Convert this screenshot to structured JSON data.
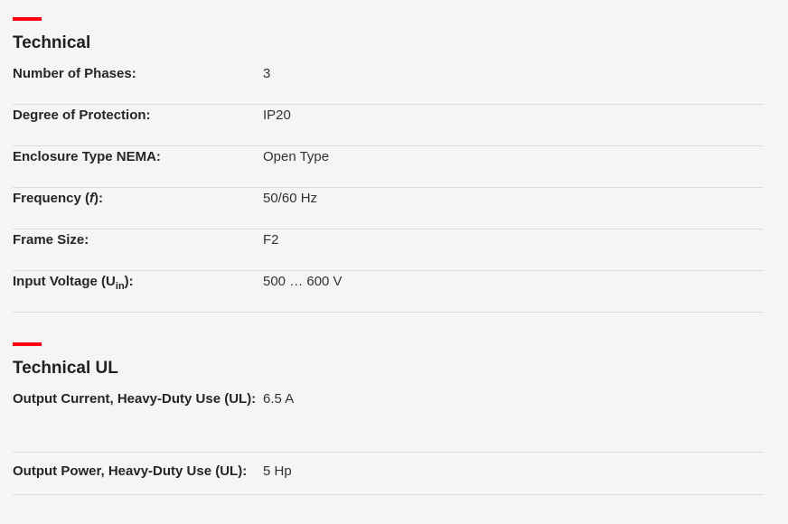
{
  "sections": [
    {
      "title": "Technical",
      "rows": [
        {
          "label": "Number of Phases:",
          "value": "3"
        },
        {
          "label": "Degree of Protection:",
          "value": "IP20"
        },
        {
          "label": "Enclosure Type NEMA:",
          "value": "Open Type"
        },
        {
          "label_prefix": "Frequency (",
          "label_italic": "f",
          "label_suffix": "):",
          "value": "50/60 Hz"
        },
        {
          "label": "Frame Size:",
          "value": "F2"
        },
        {
          "label_prefix": "Input Voltage (U",
          "label_sub": "in",
          "label_suffix": "):",
          "value": "500 … 600 V"
        }
      ]
    },
    {
      "title": "Technical UL",
      "rows": [
        {
          "label": "Output Current, Heavy-Duty Use (UL):",
          "value": "6.5 A"
        },
        {
          "label": "Output Power, Heavy-Duty Use (UL):",
          "value": "5 Hp"
        }
      ]
    }
  ],
  "colors": {
    "accent": "#ff000f",
    "background": "#f5f5f5",
    "divider": "#dcdcdc"
  }
}
